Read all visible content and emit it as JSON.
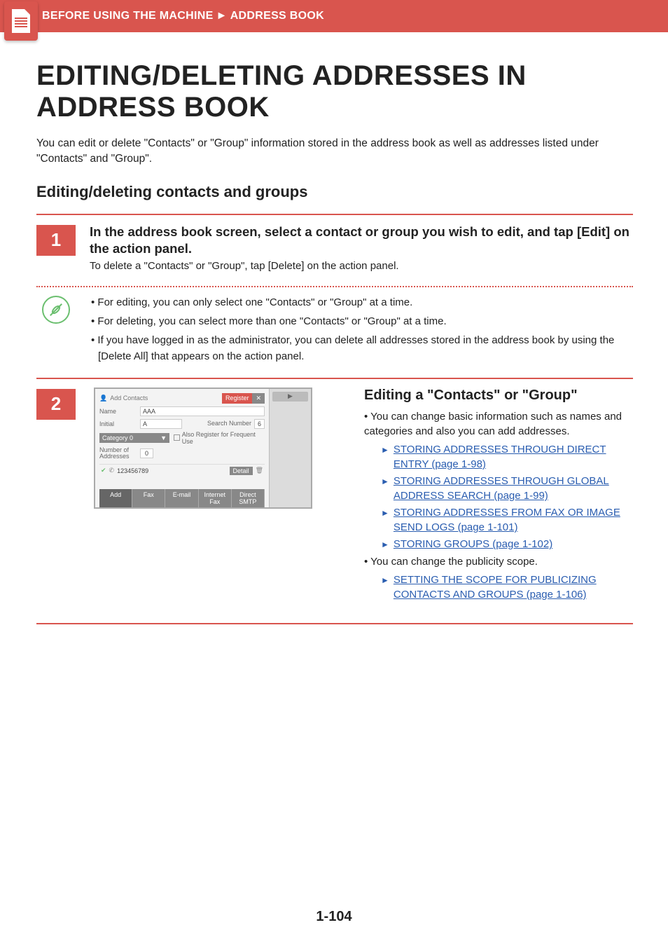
{
  "breadcrumb": {
    "a": "BEFORE USING THE MACHINE",
    "sep": "►",
    "b": "ADDRESS BOOK"
  },
  "title": "EDITING/DELETING ADDRESSES IN ADDRESS BOOK",
  "intro": "You can edit or delete \"Contacts\" or \"Group\" information stored in the address book as well as addresses listed under \"Contacts\" and \"Group\".",
  "section": "Editing/deleting contacts and groups",
  "step1": {
    "num": "1",
    "title": "In the address book screen, select a contact or group you wish to edit, and tap [Edit] on the action panel.",
    "text": "To delete a \"Contacts\" or \"Group\", tap [Delete] on the action panel.",
    "notes": [
      "For editing, you can only select one \"Contacts\" or \"Group\" at a time.",
      "For deleting, you can select more than one \"Contacts\" or \"Group\" at a time.",
      "If you have logged in as the administrator, you can delete all addresses stored in the address book by using the [Delete All] that appears on the action panel."
    ]
  },
  "step2": {
    "num": "2",
    "heading": "Editing a \"Contacts\" or \"Group\"",
    "b1": "You can change basic information such as names and categories and also you can add addresses.",
    "links1": [
      "STORING ADDRESSES THROUGH DIRECT ENTRY (page 1-98)",
      "STORING ADDRESSES THROUGH GLOBAL ADDRESS SEARCH (page 1-99)",
      "STORING ADDRESSES FROM FAX OR IMAGE SEND LOGS (page 1-101)",
      "STORING GROUPS (page 1-102)"
    ],
    "b2": "You can change the publicity scope.",
    "links2": [
      "SETTING THE SCOPE FOR PUBLICIZING CONTACTS AND GROUPS (page 1-106)"
    ]
  },
  "ui": {
    "addcontacts": "Add Contacts",
    "register": "Register",
    "x": "✕",
    "name_l": "Name",
    "name_v": "AAA",
    "init_l": "Initial",
    "init_v": "A",
    "srch_l": "Search Number",
    "srch_v": "6",
    "cat": "Category 0",
    "cat_ar": "▼",
    "cb": "Also Register for Frequent Use",
    "noa_l": "Number of Addresses",
    "noa_v": "0",
    "tel": "123456789",
    "detail": "Detail",
    "tabs": {
      "t1": "Add",
      "t2": "Fax",
      "t3": "E-mail",
      "t4": "Internet Fax",
      "t5": "Direct SMTP"
    },
    "side": "▶"
  },
  "pagenum": "1-104"
}
